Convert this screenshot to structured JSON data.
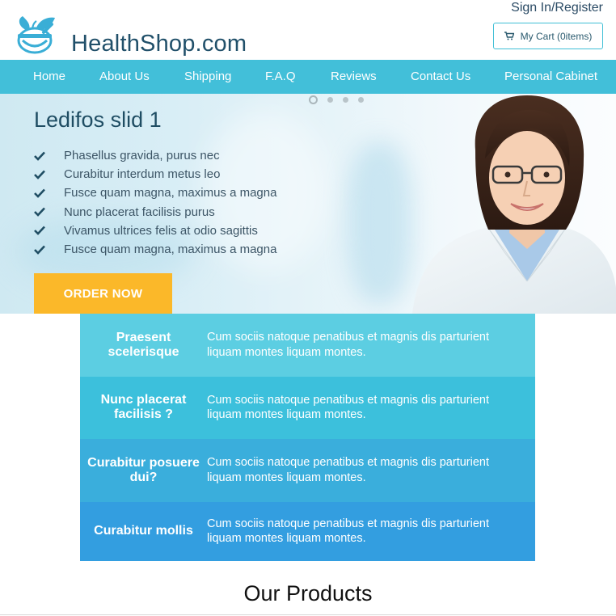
{
  "header": {
    "logo_text": "HealthShop.com",
    "signin": "Sign In/Register",
    "cart_label": "My Cart (0items)",
    "colors": {
      "brand": "#21506a",
      "accent": "#42bfd9"
    }
  },
  "nav": {
    "items": [
      {
        "label": "Home"
      },
      {
        "label": "About Us"
      },
      {
        "label": "Shipping"
      },
      {
        "label": "F.A.Q"
      },
      {
        "label": "Reviews"
      },
      {
        "label": "Contact Us"
      },
      {
        "label": "Personal Cabinet"
      }
    ]
  },
  "hero": {
    "title": "Ledifos slid 1",
    "features": [
      "Phasellus gravida, purus nec",
      "Curabitur interdum metus leo",
      "Fusce quam magna, maximus a magna",
      "Nunc placerat facilisis purus",
      "Vivamus ultrices felis at odio sagittis",
      "Fusce quam magna, maximus a magna"
    ],
    "order_button": "ORDER NOW",
    "slides_total": 4,
    "active_slide": 1
  },
  "info": {
    "rows": [
      {
        "heading": "Praesent scelerisque",
        "text": "Cum sociis natoque penatibus et magnis dis parturient liquam montes liquam montes.",
        "color": "#5ccee2"
      },
      {
        "heading": "Nunc placerat facilisis ?",
        "text": "Cum sociis natoque penatibus et magnis dis parturient liquam montes liquam montes.",
        "color": "#3cc0dc"
      },
      {
        "heading": "Curabitur posuere dui?",
        "text": "Cum sociis natoque penatibus et magnis dis parturient liquam montes liquam montes.",
        "color": "#3aaedc"
      },
      {
        "heading": "Curabitur mollis",
        "text": "Cum sociis natoque penatibus et magnis dis parturient liquam montes liquam montes.",
        "color": "#339ee0"
      }
    ]
  },
  "products": {
    "title": "Our Products"
  },
  "icons": {
    "logo": "mortar-leaf-icon",
    "cart": "cart-icon",
    "feature": "check-icon"
  }
}
